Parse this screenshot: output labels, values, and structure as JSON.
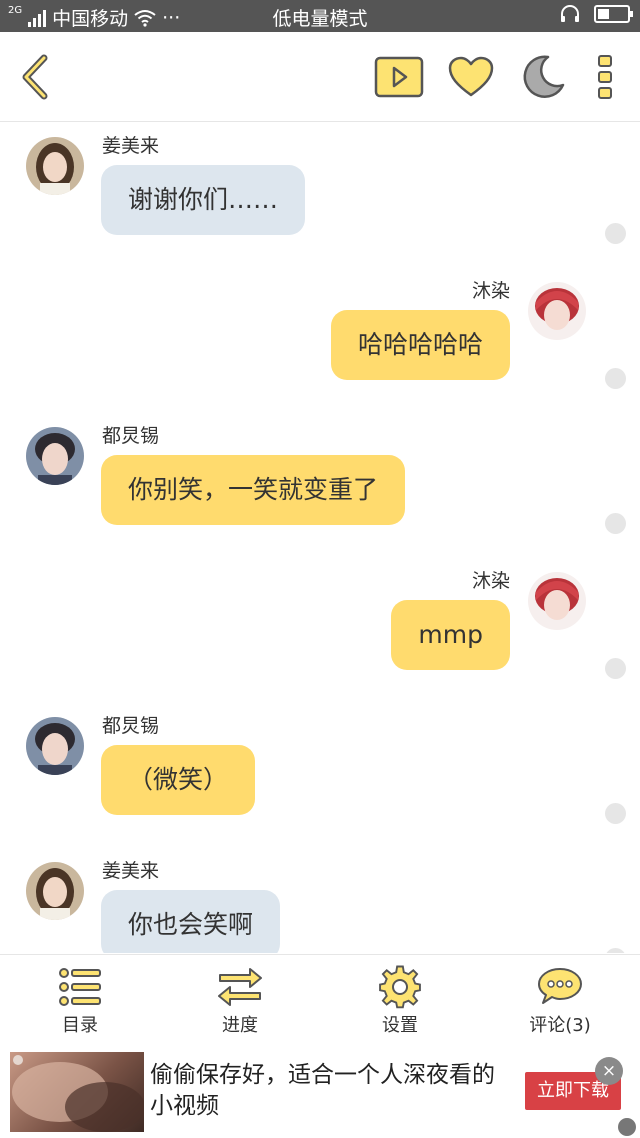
{
  "status_bar": {
    "network": "2G",
    "carrier": "中国移动",
    "dots": "···",
    "mode": "低电量模式",
    "battery_level": 0.4
  },
  "toolbar": {
    "back_icon": "chevron-left-icon",
    "play_icon": "play-icon",
    "like_icon": "heart-icon",
    "night_icon": "moon-icon",
    "more_icon": "more-vertical-icon"
  },
  "messages": [
    {
      "side": "left",
      "sender": "姜美来",
      "text": "谢谢你们……",
      "color": "blue",
      "avatar": "avatar-jiang"
    },
    {
      "side": "right",
      "sender": "沐染",
      "text": "哈哈哈哈哈",
      "color": "yellow",
      "avatar": "avatar-mu"
    },
    {
      "side": "left",
      "sender": "都炅锡",
      "text": "你别笑，一笑就变重了",
      "color": "yellow",
      "avatar": "avatar-du"
    },
    {
      "side": "right",
      "sender": "沐染",
      "text": "mmp",
      "color": "yellow",
      "avatar": "avatar-mu"
    },
    {
      "side": "left",
      "sender": "都炅锡",
      "text": "（微笑）",
      "color": "yellow",
      "avatar": "avatar-du"
    },
    {
      "side": "left",
      "sender": "姜美来",
      "text": "你也会笑啊",
      "color": "blue",
      "avatar": "avatar-jiang"
    }
  ],
  "bottom_nav": {
    "catalog": "目录",
    "progress": "进度",
    "settings": "设置",
    "comments": "评论(3)"
  },
  "ad": {
    "text": "偷偷保存好，适合一个人深夜看的小视频",
    "button": "立即下载",
    "close": "×"
  },
  "colors": {
    "accent_yellow": "#ffdb6e",
    "bubble_blue": "#dde6ee",
    "icon_yellow": "#fde372",
    "ad_red": "#d84145"
  }
}
